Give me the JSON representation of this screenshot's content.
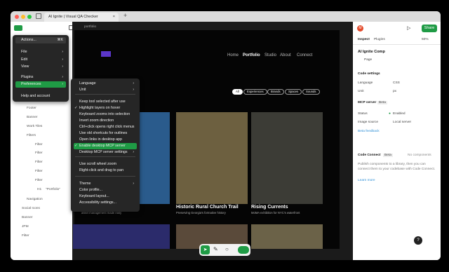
{
  "window": {
    "tab_title": "AI Ignite | Visual QA Checker",
    "new_tab": "+"
  },
  "left_panel": {
    "actions_menu": {
      "label": "Actions...",
      "shortcut": "⌘K",
      "items": [
        "File",
        "Edit",
        "View",
        "Plugins",
        "Preferences",
        "Help and account"
      ]
    },
    "layers": [
      "Footer",
      "Banner",
      "Work Tiles",
      "Filters",
      "Filter",
      "Filter",
      "Filter",
      "Filter",
      "Filter",
      "H1",
      "\"Portfolio\"",
      "Navigation",
      "Social Icons",
      "Banner",
      "JPM",
      "Filter"
    ]
  },
  "preferences_menu": {
    "items": [
      "Language",
      "Unit",
      "Keep tool selected after use",
      "Highlight layers on hover",
      "Keyboard zooms into selection",
      "Invert zoom direction",
      "Ctrl+click opens right click menus",
      "Use old shortcuts for outlines",
      "Open links in desktop app",
      "Enable desktop MCP server",
      "Desktop MCP server settings",
      "Use scroll wheel zoom",
      "Right-click and drag to pan",
      "Theme",
      "Color profile...",
      "Keyboard layout...",
      "Accessibility settings..."
    ]
  },
  "canvas": {
    "frame_label": "portfolio",
    "nav": [
      "Home",
      "Portfolio",
      "Studio",
      "About",
      "Connect"
    ],
    "filters": [
      "All",
      "Experiences",
      "Brands",
      "Spaces",
      "Sounds"
    ],
    "tiles": [
      {
        "title": "Historic Rural Church Trail",
        "subtitle": "Preserving Georgia's formative history"
      },
      {
        "title": "Rising Currents",
        "subtitle": "MoMA exhibition for NYC's waterfront"
      }
    ],
    "partial_subtitle": "asset management made easy",
    "toolbar": [
      "pointer",
      "pen",
      "comment",
      "dev"
    ]
  },
  "right_panel": {
    "avatar": "M",
    "share": "Share",
    "tabs": [
      "Inspect",
      "Plugins"
    ],
    "zoom": "50%",
    "comp_name": "AI Ignite Comp",
    "page": "Page",
    "code_settings": "Code settings",
    "language_label": "Language",
    "language_value": "CSS",
    "unit_label": "Unit",
    "unit_value": "px",
    "mcp_title": "MCP server",
    "mcp_badge": "Beta",
    "status_label": "Status",
    "status_value": "Enabled",
    "image_source_label": "Image source",
    "image_source_value": "Local server",
    "feedback": "Beta feedback",
    "code_connect": "Code Connect",
    "code_connect_badge": "Beta",
    "no_components": "No components",
    "publish_text": "Publish components to a library, then you can connect them to your codebase with Code Connect.",
    "learn_more": "Learn more",
    "help": "?"
  }
}
